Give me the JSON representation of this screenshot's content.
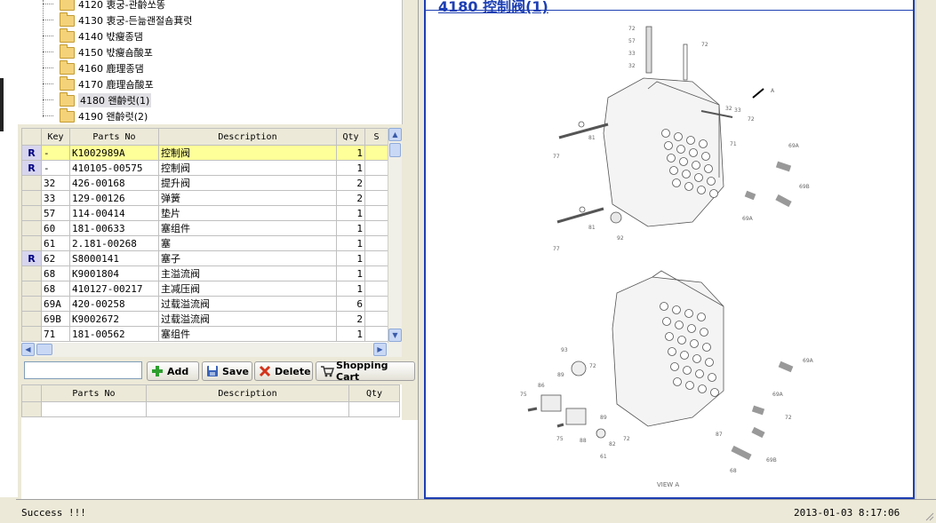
{
  "tree": {
    "items": [
      {
        "code": "4120",
        "label": "衷궁-관齡쏘똥"
      },
      {
        "code": "4130",
        "label": "衷궁-든늚괜절숌萁럿"
      },
      {
        "code": "4140",
        "label": "뱏瘦종댐"
      },
      {
        "code": "4150",
        "label": "뱏瘦숌酸포"
      },
      {
        "code": "4160",
        "label": "鹿理종댐"
      },
      {
        "code": "4170",
        "label": "鹿理숌酸포"
      },
      {
        "code": "4180",
        "label": "왠齡럿(1)",
        "selected": true
      },
      {
        "code": "4190",
        "label": "왠齡럿(2)"
      }
    ]
  },
  "parts_grid": {
    "columns": [
      "Key",
      "Parts No",
      "Description",
      "Qty",
      "S"
    ],
    "rows": [
      {
        "indicator": "R",
        "key": "-",
        "parts_no": "K1002989A",
        "description": "控制阀",
        "qty": "1",
        "highlight": true
      },
      {
        "indicator": "R",
        "key": "-",
        "parts_no": "410105-00575",
        "description": "控制阀",
        "qty": "1"
      },
      {
        "indicator": "",
        "key": "32",
        "parts_no": "426-00168",
        "description": "提升阀",
        "qty": "2"
      },
      {
        "indicator": "",
        "key": "33",
        "parts_no": "129-00126",
        "description": "弹簧",
        "qty": "2"
      },
      {
        "indicator": "",
        "key": "57",
        "parts_no": "114-00414",
        "description": "垫片",
        "qty": "1"
      },
      {
        "indicator": "",
        "key": "60",
        "parts_no": "181-00633",
        "description": "塞组件",
        "qty": "1"
      },
      {
        "indicator": "",
        "key": "61",
        "parts_no": "2.181-00268",
        "description": "塞",
        "qty": "1"
      },
      {
        "indicator": "R",
        "key": "62",
        "parts_no": "S8000141",
        "description": "塞子",
        "qty": "1"
      },
      {
        "indicator": "",
        "key": "68",
        "parts_no": "K9001804",
        "description": "主溢流阀",
        "qty": "1"
      },
      {
        "indicator": "",
        "key": "68",
        "parts_no": "410127-00217",
        "description": "主减压阀",
        "qty": "1"
      },
      {
        "indicator": "",
        "key": "69A",
        "parts_no": "420-00258",
        "description": "过载溢流阀",
        "qty": "6"
      },
      {
        "indicator": "",
        "key": "69B",
        "parts_no": "K9002672",
        "description": "过载溢流阀",
        "qty": "2"
      },
      {
        "indicator": "",
        "key": "71",
        "parts_no": "181-00562",
        "description": "塞组件",
        "qty": "1"
      }
    ]
  },
  "toolbar": {
    "search_value": "",
    "add_label": "Add",
    "save_label": "Save",
    "delete_label": "Delete",
    "cart_label": "Shopping Cart"
  },
  "cart_grid": {
    "columns": [
      "Parts No",
      "Description",
      "Qty"
    ]
  },
  "diagram": {
    "title": "4180 控制阀(1)",
    "callouts_top": [
      "72",
      "57",
      "33",
      "32",
      "72",
      "A",
      "32",
      "33",
      "72",
      "81",
      "77",
      "71",
      "69A",
      "69B",
      "69A",
      "81",
      "92",
      "77"
    ],
    "callouts_bottom": [
      "93",
      "69A",
      "72",
      "89",
      "86",
      "75",
      "69A",
      "72",
      "89",
      "75",
      "88",
      "82",
      "72",
      "87",
      "61",
      "69B",
      "68"
    ],
    "view_label": "VIEW  A"
  },
  "status": {
    "message": "Success !!!",
    "timestamp": "2013-01-03  8:17:06"
  },
  "colors": {
    "accent": "#1d3fb3",
    "highlight_row": "#ffff99",
    "indicator_bg": "#d7d5ee"
  }
}
